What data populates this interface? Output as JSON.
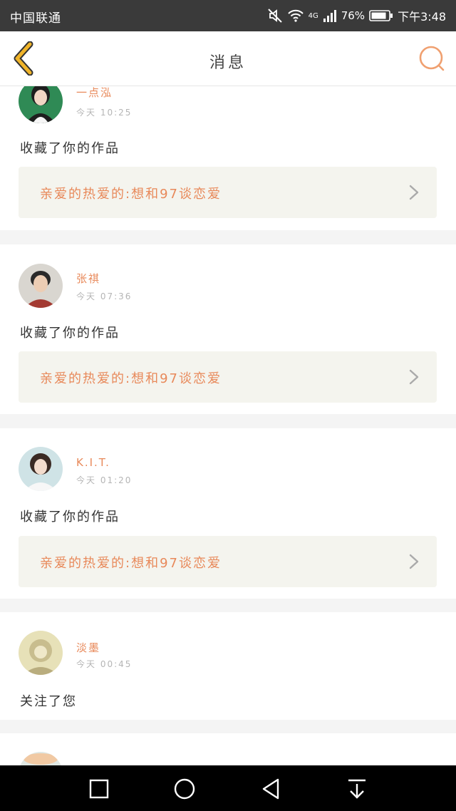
{
  "status_bar": {
    "carrier": "中国联通",
    "network": "4G",
    "battery": "76%",
    "time": "下午3:48"
  },
  "header": {
    "title": "消息"
  },
  "messages": [
    {
      "name": "一点泓",
      "time": "今天 10:25",
      "action": "收藏了你的作品",
      "work_title": "亲爱的热爱的:想和97谈恋爱"
    },
    {
      "name": "张祺",
      "time": "今天 07:36",
      "action": "收藏了你的作品",
      "work_title": "亲爱的热爱的:想和97谈恋爱"
    },
    {
      "name": "K.I.T.",
      "time": "今天 01:20",
      "action": "收藏了你的作品",
      "work_title": "亲爱的热爱的:想和97谈恋爱"
    },
    {
      "name": "淡墨",
      "time": "今天 00:45",
      "action": "关注了您"
    },
    {
      "name": "",
      "time": ""
    }
  ],
  "colors": {
    "accent": "#e8895a",
    "back_arrow": "#f0b429",
    "status_bar": "#3a3a3a"
  },
  "icons": {
    "back": "back-arrow-icon",
    "search": "search-icon",
    "chevron": "chevron-right-icon",
    "nav_recent": "square-icon",
    "nav_home": "circle-icon",
    "nav_back": "triangle-back-icon",
    "nav_notification": "pull-down-icon"
  }
}
